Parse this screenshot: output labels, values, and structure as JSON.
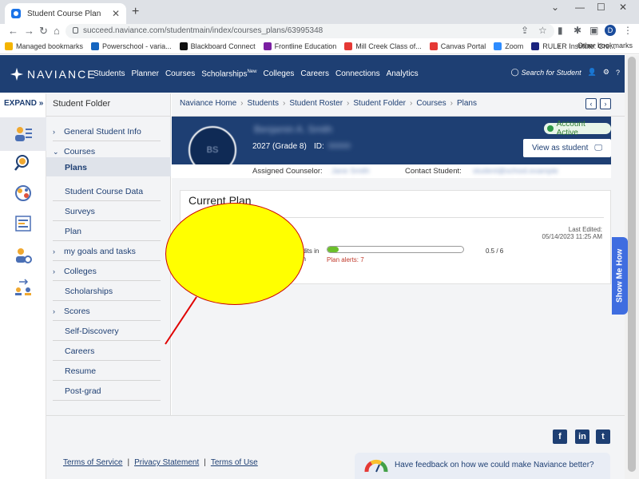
{
  "browser": {
    "tab_title": "Student Course Plan",
    "url": "succeed.naviance.com/studentmain/index/courses_plans/63995348",
    "profile_initial": "D",
    "bookmarks": [
      {
        "label": "Managed bookmarks",
        "color": "#f4b400"
      },
      {
        "label": "Powerschool - varia...",
        "color": "#1565c0"
      },
      {
        "label": "Blackboard Connect",
        "color": "#111111"
      },
      {
        "label": "Frontline Education",
        "color": "#7b1fa2"
      },
      {
        "label": "Mill Creek Class of...",
        "color": "#e53935"
      },
      {
        "label": "Canvas Portal",
        "color": "#e53935"
      },
      {
        "label": "Zoom",
        "color": "#2d8cff"
      },
      {
        "label": "RULER Institute: Cre...",
        "color": "#1a237e"
      }
    ],
    "bookmarks_more": "»",
    "other_bookmarks": "Other bookmarks"
  },
  "topnav": {
    "logo_text": "NAVIANCE",
    "links": [
      "Students",
      "Planner",
      "Courses",
      "Scholarships",
      "Colleges",
      "Careers",
      "Connections",
      "Analytics"
    ],
    "new_badge": "New",
    "search_label": "Search for Student"
  },
  "rail": {
    "expand_label": "EXPAND",
    "icons": [
      "student-folder-icon",
      "search-icon",
      "globe-icon",
      "document-icon",
      "user-settings-icon",
      "transfer-icon"
    ]
  },
  "folder": {
    "title": "Student Folder",
    "items": [
      {
        "label": "General Student Info",
        "chevron": "›"
      },
      {
        "label": "Courses",
        "chevron": "⌄"
      },
      {
        "label": "Plans",
        "chevron": ""
      },
      {
        "label": "Student Course Data",
        "chevron": ""
      },
      {
        "label": "Surveys",
        "chevron": ""
      },
      {
        "label": "Plan",
        "chevron": ""
      },
      {
        "label": "my goals and tasks",
        "chevron": "›"
      },
      {
        "label": "Colleges",
        "chevron": "›"
      },
      {
        "label": "Scholarships",
        "chevron": ""
      },
      {
        "label": "Scores",
        "chevron": "›"
      },
      {
        "label": "Self-Discovery",
        "chevron": ""
      },
      {
        "label": "Careers",
        "chevron": ""
      },
      {
        "label": "Resume",
        "chevron": ""
      },
      {
        "label": "Post-grad",
        "chevron": ""
      }
    ]
  },
  "breadcrumb": [
    "Naviance Home",
    "Students",
    "Student Roster",
    "Student Folder",
    "Courses",
    "Plans"
  ],
  "student": {
    "initials": "BS",
    "name": "Benjamin A. Smith",
    "grade": "2027 (Grade 8)",
    "id_label": "ID:",
    "id_value": "00000",
    "status": "Account Active",
    "view_as_label": "View as student",
    "counselor_label": "Assigned Counselor:",
    "counselor_value": "Jane Smith",
    "contact_label": "Contact Student:",
    "contact_value": "student@school.example"
  },
  "plan": {
    "title": "Current Plan",
    "last_edited_label": "Last Edited:",
    "last_edited_value": "05/14/2023 11:25 AM",
    "credits_label": "edits in",
    "credits_sub": "an",
    "credits_value": "0.5 / 6",
    "progress_fraction": 0.08,
    "plan_alerts": "Plan alerts: 7"
  },
  "show_me_how": "Show Me How",
  "footer": {
    "social": [
      "f",
      "in",
      "t"
    ],
    "links": [
      "Terms of Service",
      "Privacy Statement",
      "Terms of Use"
    ],
    "feedback": "Have feedback on how we could make Naviance better?"
  }
}
